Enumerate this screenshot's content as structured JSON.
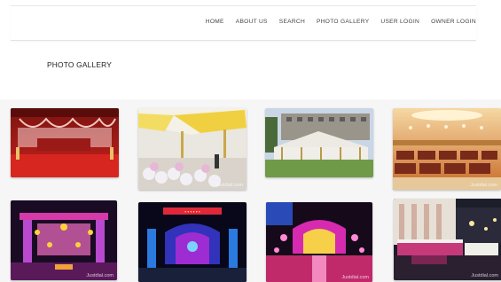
{
  "nav": {
    "items": [
      "HOME",
      "ABOUT US",
      "SEARCH",
      "PHOTO GALLERY",
      "USER LOGIN",
      "OWNER LOGIN"
    ]
  },
  "page": {
    "title": "PHOTO GALLERY"
  },
  "gallery": {
    "photos": [
      {
        "name": "photo-red-stage-decor",
        "watermark": ""
      },
      {
        "name": "photo-outdoor-tent-yellow",
        "watermark": "Justdial.com"
      },
      {
        "name": "photo-lawn-pavilion-building",
        "watermark": ""
      },
      {
        "name": "photo-banquet-hall-chairs",
        "watermark": "Justdial.com"
      },
      {
        "name": "photo-lit-gate-purple",
        "watermark": "Justdial.com"
      },
      {
        "name": "photo-night-entrance-blue",
        "watermark": ""
      },
      {
        "name": "photo-lit-stage-pink",
        "watermark": "Justdial.com"
      },
      {
        "name": "photo-buffet-tables",
        "watermark": "Justdial.com"
      }
    ]
  }
}
